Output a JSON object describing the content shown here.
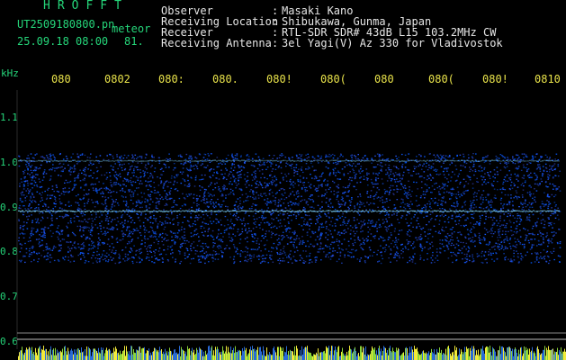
{
  "header": {
    "title": "HROFFT",
    "filename": "UT2509180800.pn",
    "mode": "meteor",
    "datetime": "25.09.18 08:00",
    "count": "81.",
    "info": [
      {
        "label": "Observer",
        "value": "Masaki Kano"
      },
      {
        "label": "Receiving Location",
        "value": "Shibukawa, Gunma, Japan"
      },
      {
        "label": "Receiver",
        "value": "RTL-SDR SDR# 43dB L15 103.2MHz CW"
      },
      {
        "label": "Receiving Antenna",
        "value": "3el Yagi(V) Az 330 for Vladivostok"
      }
    ]
  },
  "time_ticks": [
    "080",
    "0802",
    "080:",
    "080.",
    "080!",
    "080(",
    "080",
    "080(",
    "080!",
    "0810"
  ],
  "freq_axis": {
    "unit": "kHz",
    "ticks": [
      "1.1",
      "1.0",
      "0.9",
      "0.8",
      "0.7",
      "0.6"
    ]
  },
  "colors": {
    "background": "#000000",
    "header_text": "#25d67a",
    "info_text": "#e6e6e6",
    "tick_text": "#e8e24a",
    "noise": "#1a2fd0",
    "signal": "#7fd6ff"
  }
}
